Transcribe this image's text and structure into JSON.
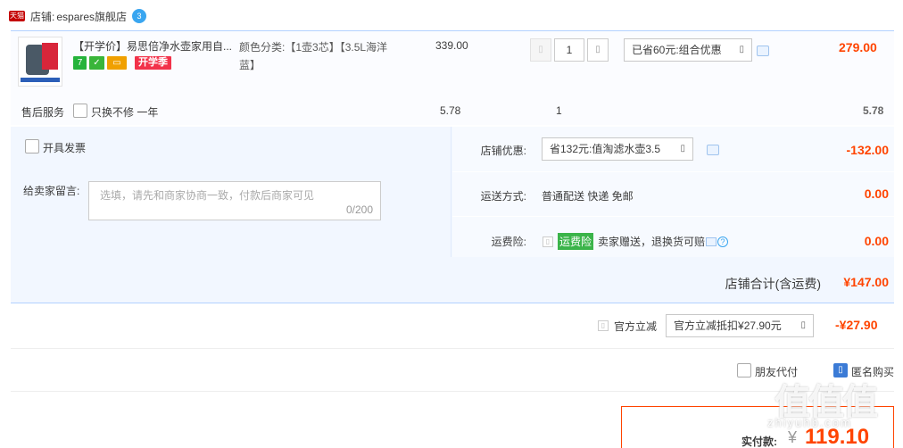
{
  "shop": {
    "label": "店铺:",
    "name": "espares旗舰店",
    "platform_badge": "天猫",
    "ww_icon": "wangwang-icon"
  },
  "item": {
    "title": "【开学价】易思倍净水壶家用自...",
    "badges": [
      "7",
      "",
      "",
      "开学季"
    ],
    "sku_label": "颜色分类:",
    "sku_value": "【1壶3芯】【3.5L海洋蓝】",
    "unit_price": "339.00",
    "quantity": "1",
    "promo": "已省60元:组合优惠",
    "total": "279.00"
  },
  "service": {
    "label": "售后服务",
    "option": "只换不修  一年",
    "price": "5.78",
    "qty": "1",
    "total": "5.78"
  },
  "extra": {
    "invoice_label": "开具发票",
    "message_label": "给卖家留言:",
    "message_placeholder": "选填，请先和商家协商一致，付款后商家可见",
    "message_count": "0/200",
    "shop_promo_label": "店铺优惠:",
    "shop_promo_value": "省132元:值淘滤水壶3.5",
    "shop_promo_amount": "-132.00",
    "shipping_label": "运送方式:",
    "shipping_value": "普通配送 快递 免邮",
    "shipping_amount": "0.00",
    "insurance_label": "运费险:",
    "insurance_tag": "运费险",
    "insurance_text": "卖家赠送，退换货可赔",
    "insurance_amount": "0.00",
    "subtotal_label": "店铺合计(含运费)",
    "subtotal_value": "¥147.00"
  },
  "gov": {
    "label": "官方立减",
    "select_value": "官方立减抵扣¥27.90元",
    "amount": "-¥27.90"
  },
  "options": {
    "friend_pay": "朋友代付",
    "anonymous": "匿名购买"
  },
  "payment": {
    "label": "实付款:",
    "currency": "¥",
    "amount": "119.10"
  },
  "watermark": {
    "main": "值值值",
    "sub": "zhiyuhb.com"
  }
}
